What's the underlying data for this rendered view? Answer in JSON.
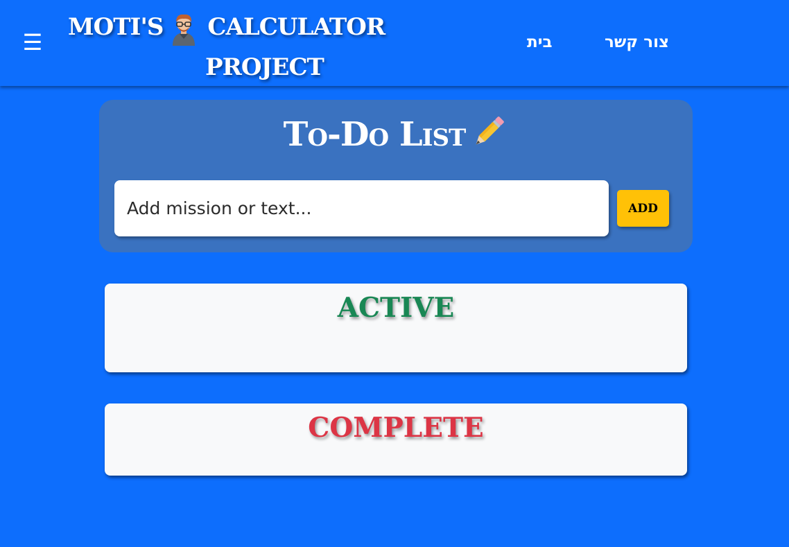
{
  "colors": {
    "page_background": "#0d6efd",
    "card_background": "#3a72c0",
    "add_button": "#ffc107",
    "active_title": "#198754",
    "complete_title": "#dc3545",
    "section_background": "#f8f9fa"
  },
  "header": {
    "menu_icon": "☰",
    "menu_icon_name": "hamburger-menu-icon",
    "brand_line1_before_avatar": "MOTI'S",
    "brand_line1_after_avatar": "CALCULATOR",
    "brand_line2": "PROJECT",
    "avatar_icon_name": "developer-avatar-icon",
    "nav_home": "בית",
    "nav_contact": "צור קשר"
  },
  "todo": {
    "title": "To-Do List",
    "title_icon_name": "pencil-icon",
    "input_placeholder": "Add mission or text...",
    "input_value": "",
    "add_label": "ADD"
  },
  "sections": {
    "active_title": "ACTIVE",
    "complete_title": "COMPLETE",
    "active_items": [],
    "complete_items": []
  }
}
